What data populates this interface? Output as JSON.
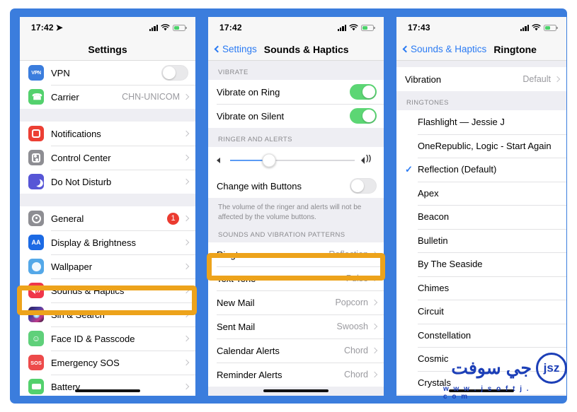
{
  "theme": {
    "frame_color": "#3b7ddd",
    "highlight_color": "#eda31b",
    "accent_blue": "#2b7bf3",
    "toggle_green": "#5cd674",
    "badge_red": "#eb3b30",
    "watermark_blue": "#1c3fb7"
  },
  "panel1": {
    "status": {
      "time": "17:42",
      "location_icon": "location-arrow-icon",
      "signal_icon": "cellular-bars-icon",
      "wifi_icon": "wifi-icon",
      "battery_icon": "battery-charging-icon"
    },
    "nav": {
      "title": "Settings"
    },
    "groups": [
      {
        "rows": [
          {
            "icon": "vpn-icon",
            "icon_text": "VPN",
            "label": "VPN",
            "control": "toggle",
            "toggle_on": false
          },
          {
            "icon": "phone-icon",
            "icon_text": "",
            "label": "Carrier",
            "value": "CHN-UNICOM",
            "control": "chevron"
          }
        ]
      },
      {
        "rows": [
          {
            "icon": "notifications-icon",
            "icon_text": "",
            "label": "Notifications",
            "value": "",
            "control": "chevron"
          },
          {
            "icon": "control-center-icon",
            "icon_text": "",
            "label": "Control Center",
            "value": "",
            "control": "chevron"
          },
          {
            "icon": "do-not-disturb-icon",
            "icon_text": "",
            "label": "Do Not Disturb",
            "value": "",
            "control": "chevron"
          }
        ]
      },
      {
        "rows": [
          {
            "icon": "general-gear-icon",
            "icon_text": "",
            "label": "General",
            "badge": "1",
            "control": "chevron"
          },
          {
            "icon": "display-brightness-icon",
            "icon_text": "AA",
            "label": "Display & Brightness",
            "value": "",
            "control": "chevron"
          },
          {
            "icon": "wallpaper-icon",
            "icon_text": "",
            "label": "Wallpaper",
            "value": "",
            "control": "chevron"
          },
          {
            "icon": "sounds-haptics-icon",
            "icon_text": "",
            "label": "Sounds & Haptics",
            "value": "",
            "control": "chevron",
            "highlighted": true
          },
          {
            "icon": "siri-search-icon",
            "icon_text": "",
            "label": "Siri & Search",
            "value": "",
            "control": "chevron"
          },
          {
            "icon": "face-id-icon",
            "icon_text": "",
            "label": "Face ID & Passcode",
            "value": "",
            "control": "chevron"
          },
          {
            "icon": "emergency-sos-icon",
            "icon_text": "SOS",
            "label": "Emergency SOS",
            "value": "",
            "control": "chevron"
          },
          {
            "icon": "battery-icon",
            "icon_text": "",
            "label": "Battery",
            "value": "",
            "control": "chevron"
          }
        ]
      }
    ]
  },
  "panel2": {
    "status": {
      "time": "17:42",
      "signal_icon": "cellular-bars-icon",
      "wifi_icon": "wifi-icon",
      "battery_icon": "battery-charging-icon"
    },
    "nav": {
      "back_label": "Settings",
      "title": "Sounds & Haptics"
    },
    "section_vibrate": {
      "header": "VIBRATE",
      "rows": [
        {
          "label": "Vibrate on Ring",
          "toggle_on": true
        },
        {
          "label": "Vibrate on Silent",
          "toggle_on": true
        }
      ]
    },
    "section_ringer": {
      "header": "RINGER AND ALERTS",
      "slider": {
        "left_icon": "speaker-low-icon",
        "right_icon": "speaker-high-icon",
        "value_percent": 31
      },
      "change_with_buttons": {
        "label": "Change with Buttons",
        "toggle_on": false
      },
      "footnote": "The volume of the ringer and alerts will not be affected by the volume buttons."
    },
    "section_patterns": {
      "header": "SOUNDS AND VIBRATION PATTERNS",
      "rows": [
        {
          "label": "Ringtone",
          "value": "Reflection",
          "highlighted": true
        },
        {
          "label": "Text Tone",
          "value": "Pulse"
        },
        {
          "label": "New Mail",
          "value": "Popcorn"
        },
        {
          "label": "Sent Mail",
          "value": "Swoosh"
        },
        {
          "label": "Calendar Alerts",
          "value": "Chord"
        },
        {
          "label": "Reminder Alerts",
          "value": "Chord"
        }
      ]
    }
  },
  "panel3": {
    "status": {
      "time": "17:43",
      "signal_icon": "cellular-bars-icon",
      "wifi_icon": "wifi-icon",
      "battery_icon": "battery-charging-icon"
    },
    "nav": {
      "back_label": "Sounds & Haptics",
      "title": "Ringtone"
    },
    "vibration_row": {
      "label": "Vibration",
      "value": "Default"
    },
    "section_ringtones": {
      "header": "RINGTONES",
      "items": [
        {
          "label": "Flashlight — Jessie J",
          "selected": false
        },
        {
          "label": "OneRepublic,  Logic - Start Again",
          "selected": false
        },
        {
          "label": "Reflection (Default)",
          "selected": true
        },
        {
          "label": "Apex",
          "selected": false
        },
        {
          "label": "Beacon",
          "selected": false
        },
        {
          "label": "Bulletin",
          "selected": false
        },
        {
          "label": "By The Seaside",
          "selected": false
        },
        {
          "label": "Chimes",
          "selected": false
        },
        {
          "label": "Circuit",
          "selected": false
        },
        {
          "label": "Constellation",
          "selected": false
        },
        {
          "label": "Cosmic",
          "selected": false
        },
        {
          "label": "Crystals",
          "selected": false
        }
      ]
    }
  },
  "watermark": {
    "brand_ar": "جي سوفت",
    "logo_text": "jsz",
    "url": "w w w . j s o f t j . c o m"
  }
}
